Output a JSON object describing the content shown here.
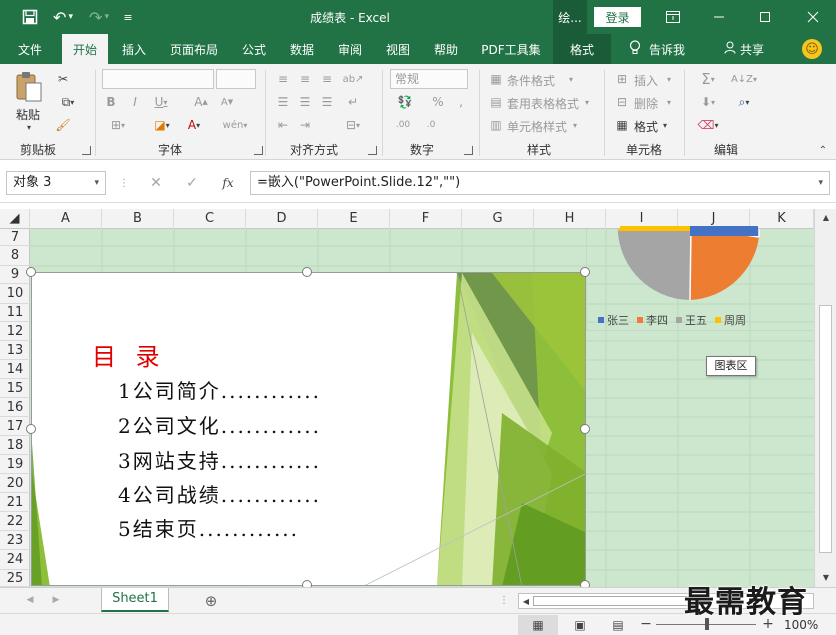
{
  "window": {
    "title": "成绩表  -  Excel",
    "context_tab_label": "绘...",
    "login_label": "登录"
  },
  "ribbon_tabs": [
    {
      "label": "文件"
    },
    {
      "label": "开始"
    },
    {
      "label": "插入"
    },
    {
      "label": "页面布局"
    },
    {
      "label": "公式"
    },
    {
      "label": "数据"
    },
    {
      "label": "审阅"
    },
    {
      "label": "视图"
    },
    {
      "label": "帮助"
    },
    {
      "label": "PDF工具集"
    },
    {
      "label": "格式"
    }
  ],
  "tell_me": "告诉我",
  "share": "共享",
  "ribbon": {
    "clipboard": {
      "paste": "粘贴",
      "label": "剪贴板"
    },
    "font": {
      "label": "字体"
    },
    "alignment": {
      "label": "对齐方式"
    },
    "number": {
      "format_value": "常规",
      "label": "数字"
    },
    "styles": {
      "conditional": "条件格式",
      "table_format": "套用表格格式",
      "cell_styles": "单元格样式",
      "label": "样式"
    },
    "cells": {
      "insert": "插入",
      "delete": "删除",
      "format": "格式",
      "label": "单元格"
    },
    "editing": {
      "label": "编辑"
    }
  },
  "formula_bar": {
    "name_box": "对象 3",
    "formula": "=嵌入(\"PowerPoint.Slide.12\",\"\")"
  },
  "columns": [
    "A",
    "B",
    "C",
    "D",
    "E",
    "F",
    "G",
    "H",
    "I",
    "J",
    "K"
  ],
  "rows": [
    "7",
    "8",
    "9",
    "10",
    "11",
    "12",
    "13",
    "14",
    "15",
    "16",
    "17",
    "18",
    "19",
    "20",
    "21",
    "22",
    "23",
    "24",
    "25"
  ],
  "slide": {
    "title": "目 录",
    "items": [
      "1公司简介............",
      "2公司文化............",
      "3网站支持............",
      "4公司战绩............",
      "5结束页............"
    ]
  },
  "chart": {
    "legend": [
      {
        "name": "张三",
        "color": "#4472c4"
      },
      {
        "name": "李四",
        "color": "#ed7d31"
      },
      {
        "name": "王五",
        "color": "#a5a5a5"
      },
      {
        "name": "周周",
        "color": "#ffc000"
      }
    ],
    "tooltip": "图表区"
  },
  "sheets": [
    {
      "name": "Sheet1"
    }
  ],
  "status": {
    "zoom": "100%"
  },
  "watermark": "最需教育"
}
